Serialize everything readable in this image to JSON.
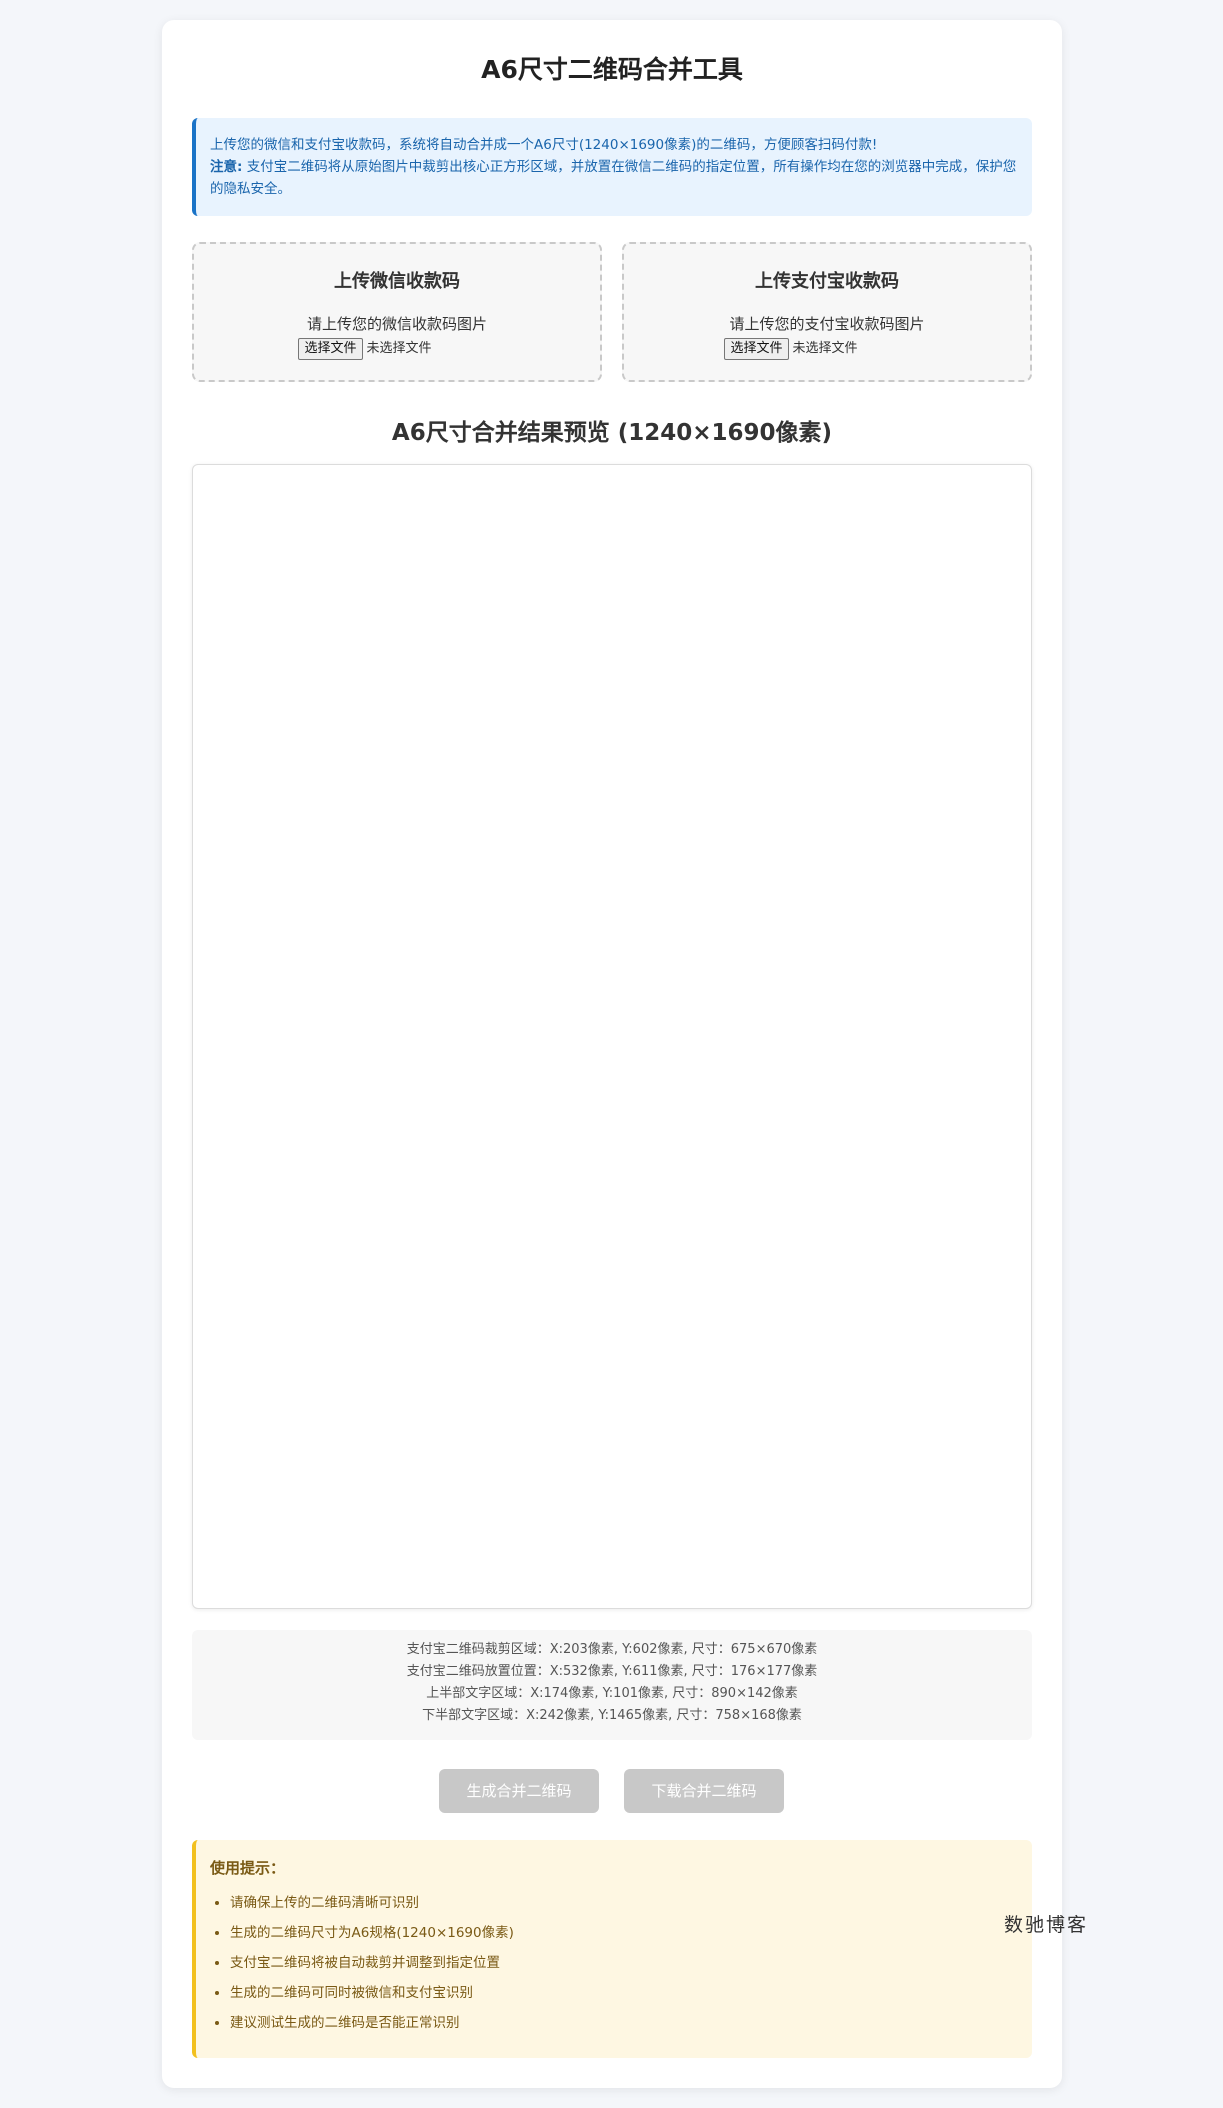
{
  "page": {
    "title": "A6尺寸二维码合并工具"
  },
  "info": {
    "line1": "上传您的微信和支付宝收款码，系统将自动合并成一个A6尺寸(1240×1690像素)的二维码，方便顾客扫码付款!",
    "note_label": "注意:",
    "note_text": " 支付宝二维码将从原始图片中裁剪出核心正方形区域，并放置在微信二维码的指定位置，所有操作均在您的浏览器中完成，保护您的隐私安全。"
  },
  "uploads": {
    "wechat": {
      "heading": "上传微信收款码",
      "hint": "请上传您的微信收款码图片",
      "button": "选择文件",
      "status": "未选择文件"
    },
    "alipay": {
      "heading": "上传支付宝收款码",
      "hint": "请上传您的支付宝收款码图片",
      "button": "选择文件",
      "status": "未选择文件"
    }
  },
  "preview": {
    "title": "A6尺寸合并结果预览 (1240×1690像素)"
  },
  "coords": [
    "支付宝二维码裁剪区域：X:203像素, Y:602像素, 尺寸：675×670像素",
    "支付宝二维码放置位置：X:532像素, Y:611像素, 尺寸：176×177像素",
    "上半部文字区域：X:174像素, Y:101像素, 尺寸：890×142像素",
    "下半部文字区域：X:242像素, Y:1465像素, 尺寸：758×168像素"
  ],
  "actions": {
    "generate": "生成合并二维码",
    "download": "下载合并二维码",
    "disabled_color": "#c8c8c8"
  },
  "tips": {
    "heading": "使用提示：",
    "items": [
      "请确保上传的二维码清晰可识别",
      "生成的二维码尺寸为A6规格(1240×1690像素)",
      "支付宝二维码将被自动裁剪并调整到指定位置",
      "生成的二维码可同时被微信和支付宝识别",
      "建议测试生成的二维码是否能正常识别"
    ]
  },
  "watermark": "数驰博客",
  "colors": {
    "accent_blue": "#1a73c7",
    "accent_yellow": "#f2c01e"
  }
}
